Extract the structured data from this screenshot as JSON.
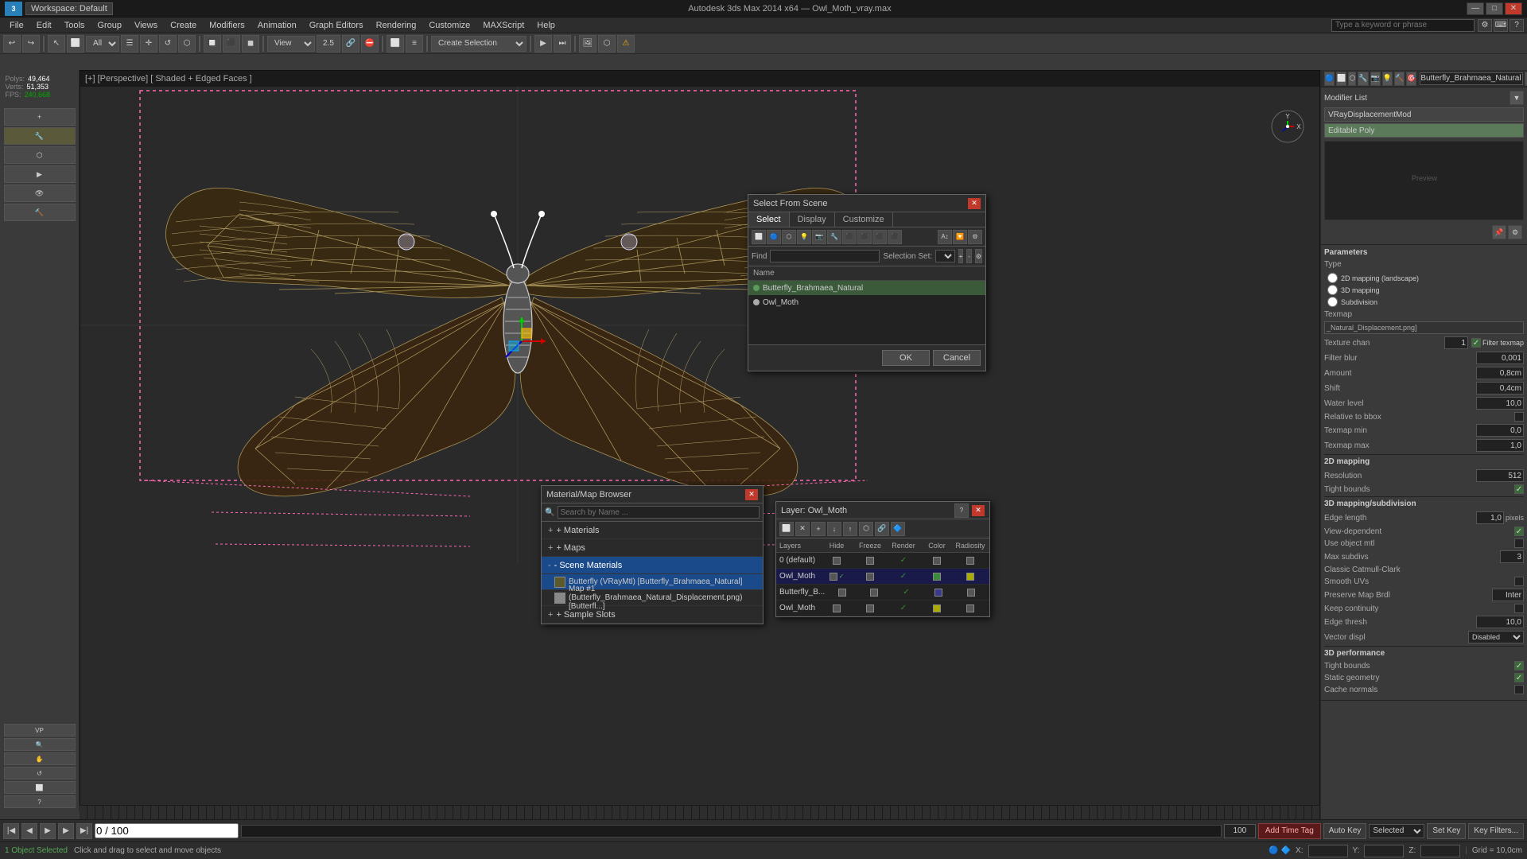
{
  "app": {
    "title": "Autodesk 3ds Max 2014 x64 — Owl_Moth_vray.max",
    "workspace": "Workspace: Default"
  },
  "titlebar": {
    "logo": "3",
    "minimize_label": "—",
    "maximize_label": "□",
    "close_label": "✕"
  },
  "menubar": {
    "items": [
      "File",
      "Edit",
      "Tools",
      "Group",
      "Views",
      "Create",
      "Modifiers",
      "Animation",
      "Graph Editors",
      "Rendering",
      "Customize",
      "MAXScript",
      "Help"
    ],
    "search_placeholder": "Type a keyword or phrase"
  },
  "viewport": {
    "label": "[+] [Perspective] [ Shaded + Edged Faces ]",
    "stats": {
      "polys_label": "Polys:",
      "polys_value": "49,464",
      "verts_label": "Verts:",
      "verts_value": "51,353",
      "fps_label": "FPS:",
      "fps_value": "240,668"
    }
  },
  "select_dialog": {
    "title": "Select From Scene",
    "close_label": "✕",
    "tabs": [
      "Select",
      "Display",
      "Customize"
    ],
    "active_tab": "Select",
    "find_label": "Find",
    "find_placeholder": "",
    "selection_set_label": "Selection Set:",
    "name_col": "Name",
    "items": [
      {
        "name": "Butterfly_Brahmaea_Natural",
        "active": false
      },
      {
        "name": "Owl_Moth",
        "active": true
      }
    ],
    "ok_label": "OK",
    "cancel_label": "Cancel"
  },
  "material_browser": {
    "title": "Material/Map Browser",
    "close_label": "✕",
    "search_placeholder": "Search by Name ...",
    "sections": [
      {
        "label": "+ Materials",
        "expanded": false
      },
      {
        "label": "+ Maps",
        "expanded": false
      },
      {
        "label": "- Scene Materials",
        "expanded": true,
        "active": true
      }
    ],
    "scene_materials": [
      {
        "name": "Butterfly (VRayMtl) [Butterfly_Brahmaea_Natural]",
        "selected": true
      },
      {
        "name": "Map #1 (Butterfly_Brahmaea_Natural_Displacement.png) [Butterfl...]",
        "selected": false
      }
    ],
    "sample_slots_label": "+ Sample Slots"
  },
  "layer_dialog": {
    "title": "Layer: Owl_Moth",
    "help_label": "?",
    "close_label": "✕",
    "columns": [
      "Layers",
      "Hide",
      "Freeze",
      "Render",
      "Color",
      "Radiosity"
    ],
    "items": [
      {
        "name": "0 (default)",
        "active": false,
        "hide": false,
        "freeze": false,
        "render": true,
        "color": "gray"
      },
      {
        "name": "Owl_Moth",
        "active": true,
        "hide": false,
        "freeze": false,
        "render": true,
        "color": "green"
      },
      {
        "name": "Butterfly_B...",
        "active": false,
        "hide": false,
        "freeze": false,
        "render": true,
        "color": "blue"
      },
      {
        "name": "Owl_Moth",
        "active": false,
        "hide": false,
        "freeze": false,
        "render": true,
        "color": "yellow"
      }
    ]
  },
  "right_panel": {
    "object_name": "Butterfly_Brahmaea_Natural",
    "modifier_list_label": "Modifier List",
    "modifiers": [
      {
        "name": "VRayDisplacementMod",
        "active": false
      },
      {
        "name": "Editable Poly",
        "active": true
      }
    ],
    "params_title": "Parameters",
    "type_section": {
      "title": "Type",
      "options": [
        "2D mapping (landscape)",
        "3D mapping",
        "Subdivision"
      ]
    },
    "texmap_label": "Texmap",
    "texmap_value": "_Natural_Displacement.png]",
    "texture_chain_label": "Texture chan",
    "texture_chain_value": "1",
    "filter_texmap_label": "Filter texmap",
    "filter_texmap_checked": true,
    "filter_blur_label": "Filter blur",
    "filter_blur_value": "0,001",
    "amount_label": "Amount",
    "amount_value": "0,8cm",
    "shift_label": "Shift",
    "shift_value": "0,4cm",
    "water_level_label": "Water level",
    "water_level_value": "10,0",
    "relative_bbox_label": "Relative to bbox",
    "relative_bbox_checked": false,
    "texmap_min_label": "Texmap min",
    "texmap_min_value": "0,0",
    "texmap_max_label": "Texmap max",
    "texmap_max_value": "1,0",
    "mapping_2d_label": "2D mapping",
    "resolution_label": "Resolution",
    "resolution_value": "512",
    "tight_bounds_label": "Tight bounds",
    "tight_bounds_checked": true,
    "mapping_3d_label": "3D mapping/subdivision",
    "edge_length_label": "Edge length",
    "edge_length_value": "1,0",
    "pixels_label": "pixels",
    "view_dependent_label": "View-dependent",
    "view_dependent_checked": true,
    "use_object_mtl_label": "Use object mtl",
    "use_object_mtl_checked": false,
    "max_subdivs_label": "Max subdivs",
    "max_subdivs_value": "3",
    "catnull_clark_label": "Classic Catmull-Clark",
    "smooth_uvs_label": "Smooth UVs",
    "smooth_uvs_checked": false,
    "preserve_map_borders_label": "Preserve Map Brdl",
    "preserve_map_borders_value": "Inter",
    "keep_continuity_label": "Keep continuity",
    "keep_continuity_checked": false,
    "edge_thresh_label": "Edge thresh",
    "edge_thresh_value": "10,0",
    "vector_disp_label": "Vector displ",
    "vector_disp_value": "Disabled",
    "dp_performance_label": "3D performance",
    "tight_bounds2_label": "Tight bounds",
    "tight_bounds2_checked": true,
    "static_geometry_label": "Static geometry",
    "static_geometry_checked": true,
    "cache_normals_label": "Cache normals",
    "cache_normals_checked": false
  },
  "bottom": {
    "object_selected": "1 Object Selected",
    "hint": "Click and drag to select and move objects",
    "x_label": "X:",
    "y_label": "Y:",
    "z_label": "Z:",
    "grid_label": "Grid = 10,0cm",
    "add_time_tag_label": "Add Time Tag",
    "auto_key_label": "Auto Key",
    "selected_label": "Selected",
    "set_key_label": "Set Key",
    "key_filters_label": "Key Filters...",
    "time_display": "0 / 100"
  }
}
